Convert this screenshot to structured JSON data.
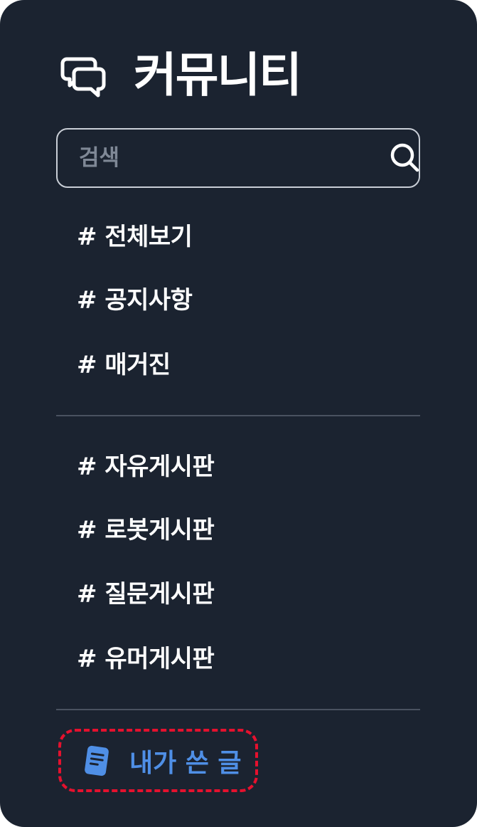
{
  "header": {
    "title": "커뮤니티",
    "icon": "chat-bubbles-icon"
  },
  "search": {
    "placeholder": "검색",
    "value": "",
    "icon": "search-icon"
  },
  "menu_group_1": [
    {
      "label": "# 전체보기"
    },
    {
      "label": "# 공지사항"
    },
    {
      "label": "# 매거진"
    }
  ],
  "menu_group_2": [
    {
      "label": "# 자유게시판"
    },
    {
      "label": "# 로봇게시판"
    },
    {
      "label": "# 질문게시판"
    },
    {
      "label": "# 유머게시판"
    }
  ],
  "my_posts": {
    "label": "내가 쓴 글",
    "icon": "document-icon"
  },
  "colors": {
    "panel_background": "#1b2330",
    "text": "#ffffff",
    "divider": "#4a5260",
    "search_border": "#c9ced6",
    "placeholder": "#7f8896",
    "accent_blue": "#4f8fe6",
    "highlight_dashed_red": "#e5112e"
  }
}
